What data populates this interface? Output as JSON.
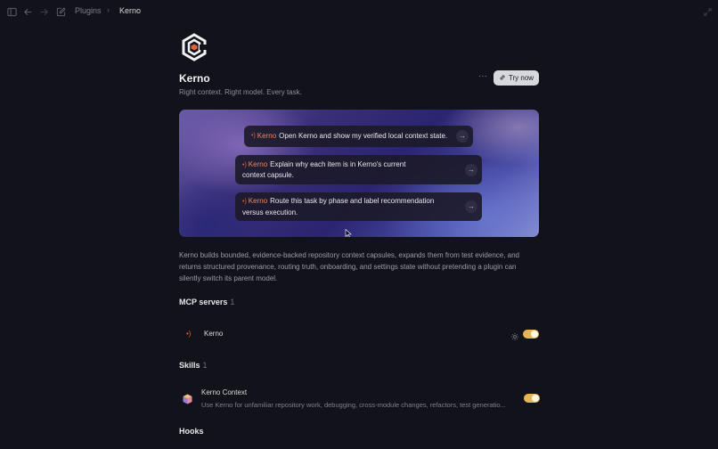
{
  "breadcrumb": {
    "parent": "Plugins",
    "separator": "›",
    "current": "Kerno"
  },
  "plugin": {
    "name": "Kerno",
    "tagline": "Right context. Right model. Every task.",
    "try_label": "Try now",
    "more_label": "···",
    "description": "Kerno builds bounded, evidence-backed repository context capsules, expands them from test evidence, and returns structured provenance, routing truth, onboarding, and settings state without pretending a plugin can silently switch its parent model."
  },
  "prompts": [
    {
      "keyword": "Kerno",
      "text": "Open Kerno and show my verified local context state."
    },
    {
      "keyword": "Kerno",
      "text": "Explain why each item is in Kerno's current context capsule."
    },
    {
      "keyword": "Kerno",
      "text": "Route this task by phase and label recommendation versus execution."
    }
  ],
  "mcp": {
    "heading": "MCP servers",
    "count": "1",
    "items": [
      {
        "name": "Kerno",
        "enabled": true
      }
    ]
  },
  "skills": {
    "heading": "Skills",
    "count": "1",
    "items": [
      {
        "name": "Kerno Context",
        "description": "Use Kerno for unfamiliar repository work, debugging, cross-module changes, refactors, test generatio...",
        "enabled": true
      }
    ]
  },
  "hooks": {
    "heading": "Hooks"
  },
  "colors": {
    "accent_toggle": "#e9b35a",
    "keyword": "#f08560",
    "background": "#12131a"
  },
  "icons": [
    "sidebar-toggle-icon",
    "back-arrow-icon",
    "forward-arrow-icon",
    "new-chat-icon",
    "fullscreen-icon",
    "kerno-logo",
    "link-icon",
    "gear-icon",
    "skill-cube-icon"
  ]
}
